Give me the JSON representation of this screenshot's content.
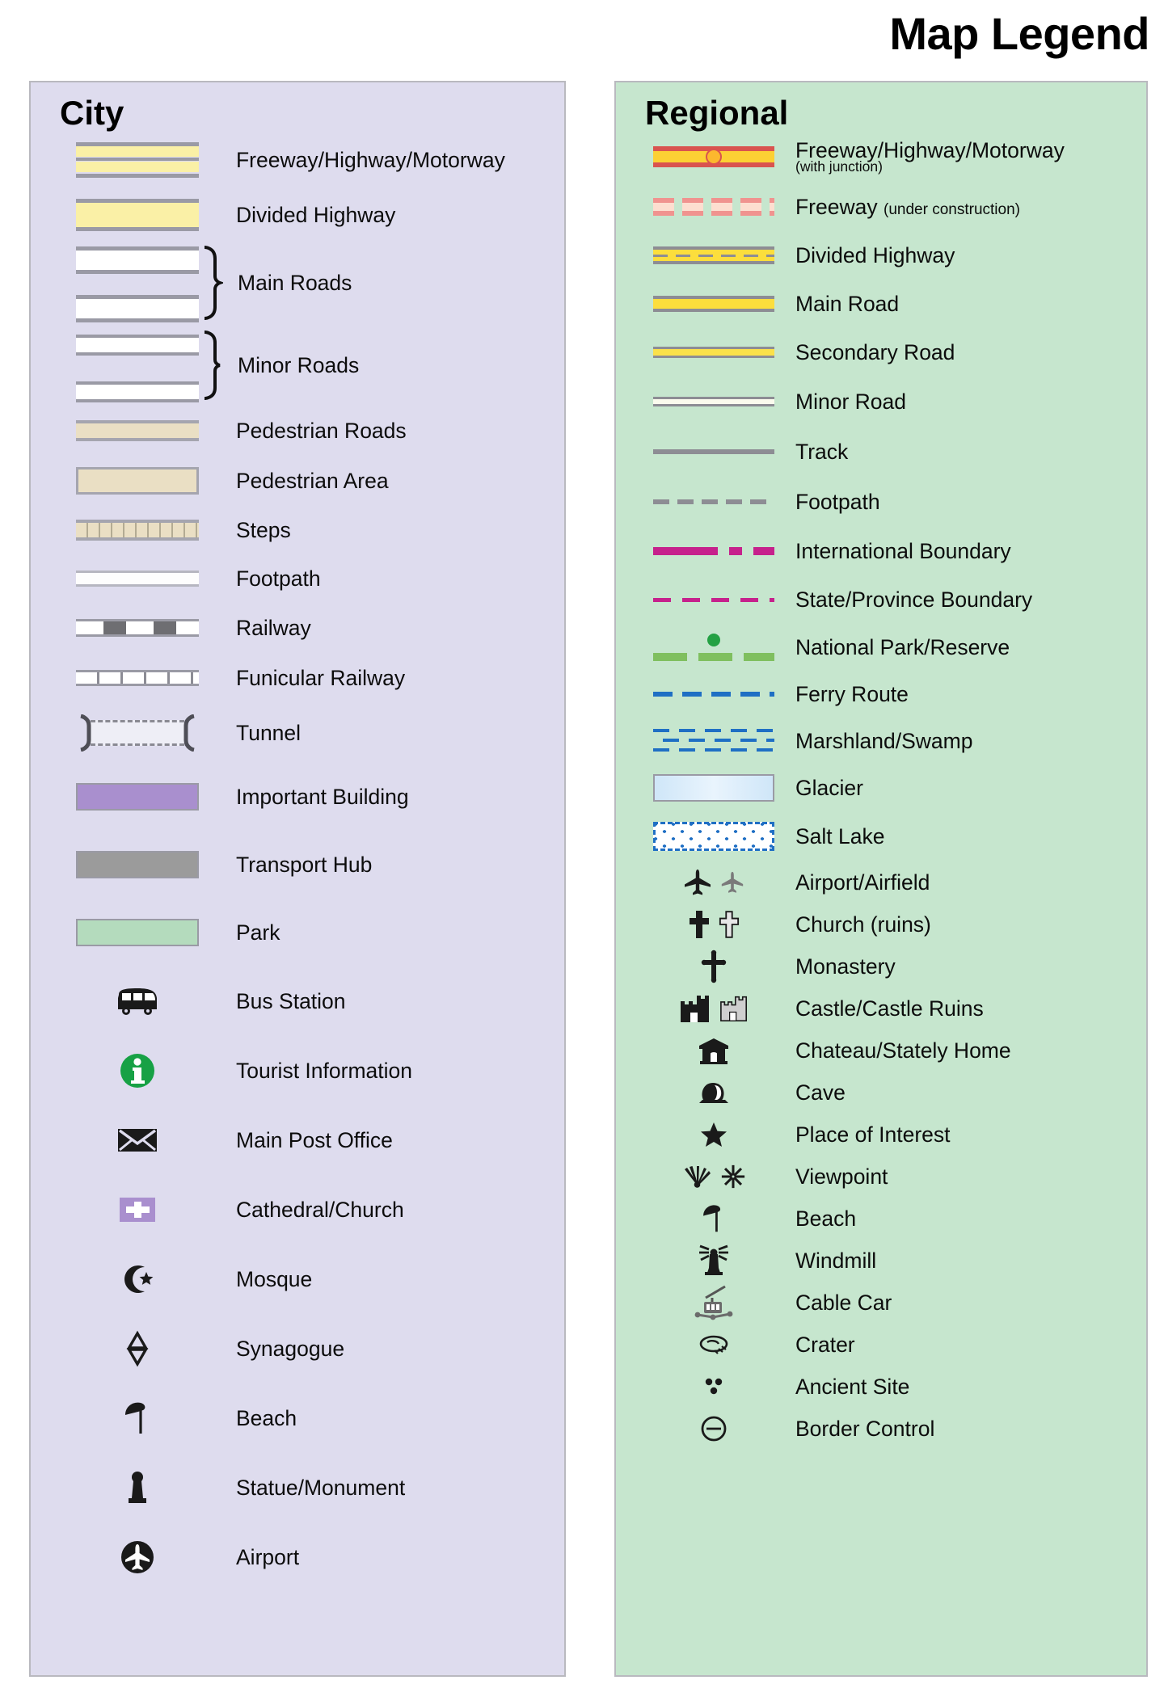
{
  "title": "Map Legend",
  "city": {
    "heading": "City",
    "items": [
      {
        "label": "Freeway/Highway/Motorway",
        "symbol": "freeway-dual-band"
      },
      {
        "label": "Divided Highway",
        "symbol": "divided-highway-band"
      },
      {
        "label": "Main Roads",
        "symbol": "white-road-pair-braced"
      },
      {
        "label": "Minor Roads",
        "symbol": "white-thin-road-pair-braced"
      },
      {
        "label": "Pedestrian Roads",
        "symbol": "tan-road-line"
      },
      {
        "label": "Pedestrian Area",
        "symbol": "tan-filled-area"
      },
      {
        "label": "Steps",
        "symbol": "segmented-steps-bar"
      },
      {
        "label": "Footpath",
        "symbol": "thin-white-line"
      },
      {
        "label": "Railway",
        "symbol": "dashed-block-railway"
      },
      {
        "label": "Funicular Railway",
        "symbol": "ticked-railway"
      },
      {
        "label": "Tunnel",
        "symbol": "bracketed-dashed-tunnel"
      },
      {
        "label": "Important Building",
        "symbol": "purple-swatch"
      },
      {
        "label": "Transport Hub",
        "symbol": "gray-swatch"
      },
      {
        "label": "Park",
        "symbol": "green-swatch"
      },
      {
        "label": "Bus Station",
        "symbol": "bus-icon"
      },
      {
        "label": "Tourist Information",
        "symbol": "information-circle-icon"
      },
      {
        "label": "Main Post Office",
        "symbol": "envelope-icon"
      },
      {
        "label": "Cathedral/Church",
        "symbol": "church-cross-box-icon"
      },
      {
        "label": "Mosque",
        "symbol": "crescent-star-icon"
      },
      {
        "label": "Synagogue",
        "symbol": "star-of-david-icon"
      },
      {
        "label": "Beach",
        "symbol": "beach-umbrella-icon"
      },
      {
        "label": "Statue/Monument",
        "symbol": "statue-icon"
      },
      {
        "label": "Airport",
        "symbol": "airport-circle-icon"
      }
    ]
  },
  "regional": {
    "heading": "Regional",
    "items": [
      {
        "label": "Freeway/Highway/Motorway",
        "sublabel": "(with junction)",
        "symbol": "freeway-junction-line"
      },
      {
        "label": "Freeway",
        "note": "(under construction)",
        "symbol": "freeway-under-construction-line"
      },
      {
        "label": "Divided Highway",
        "symbol": "divided-highway-line"
      },
      {
        "label": "Main Road",
        "symbol": "main-road-line"
      },
      {
        "label": "Secondary Road",
        "symbol": "secondary-road-line"
      },
      {
        "label": "Minor Road",
        "symbol": "minor-road-line"
      },
      {
        "label": "Track",
        "symbol": "track-line"
      },
      {
        "label": "Footpath",
        "symbol": "footpath-dashed-line"
      },
      {
        "label": "International Boundary",
        "symbol": "international-boundary-line"
      },
      {
        "label": "State/Province Boundary",
        "symbol": "state-boundary-line"
      },
      {
        "label": "National Park/Reserve",
        "symbol": "national-park-line"
      },
      {
        "label": "Ferry Route",
        "symbol": "ferry-route-line"
      },
      {
        "label": "Marshland/Swamp",
        "symbol": "marshland-pattern"
      },
      {
        "label": "Glacier",
        "symbol": "glacier-swatch"
      },
      {
        "label": "Salt Lake",
        "symbol": "salt-lake-pattern"
      },
      {
        "label": "Airport/Airfield",
        "symbol": "airplane-pair-icon"
      },
      {
        "label": "Church (ruins)",
        "symbol": "cross-pair-icon"
      },
      {
        "label": "Monastery",
        "symbol": "monastery-cross-icon"
      },
      {
        "label": "Castle/Castle Ruins",
        "symbol": "castle-pair-icon"
      },
      {
        "label": "Chateau/Stately Home",
        "symbol": "chateau-icon"
      },
      {
        "label": "Cave",
        "symbol": "cave-icon"
      },
      {
        "label": "Place of Interest",
        "symbol": "star-icon"
      },
      {
        "label": "Viewpoint",
        "symbol": "viewpoint-pair-icon"
      },
      {
        "label": "Beach",
        "symbol": "beach-umbrella-icon"
      },
      {
        "label": "Windmill",
        "symbol": "windmill-icon"
      },
      {
        "label": "Cable Car",
        "symbol": "cable-car-icon"
      },
      {
        "label": "Crater",
        "symbol": "crater-icon"
      },
      {
        "label": "Ancient Site",
        "symbol": "ancient-site-icon"
      },
      {
        "label": "Border Control",
        "symbol": "border-control-icon"
      }
    ]
  },
  "colors": {
    "city_panel_bg": "#dedcee",
    "regional_panel_bg": "#c6e6ce",
    "highway_yellow": "#faf0a6",
    "regional_yellow": "#fcde3c",
    "freeway_red": "#d9534f",
    "pedestrian_tan": "#eadfc4",
    "important_building_purple": "#a98fce",
    "transport_hub_gray": "#9b9b9b",
    "park_green": "#b4dbbd",
    "boundary_magenta": "#c6218c",
    "park_line_green": "#7fbf5f",
    "ferry_blue": "#1f6fc4",
    "glacier_blue": "#cfe6f8",
    "info_green": "#24a144"
  }
}
